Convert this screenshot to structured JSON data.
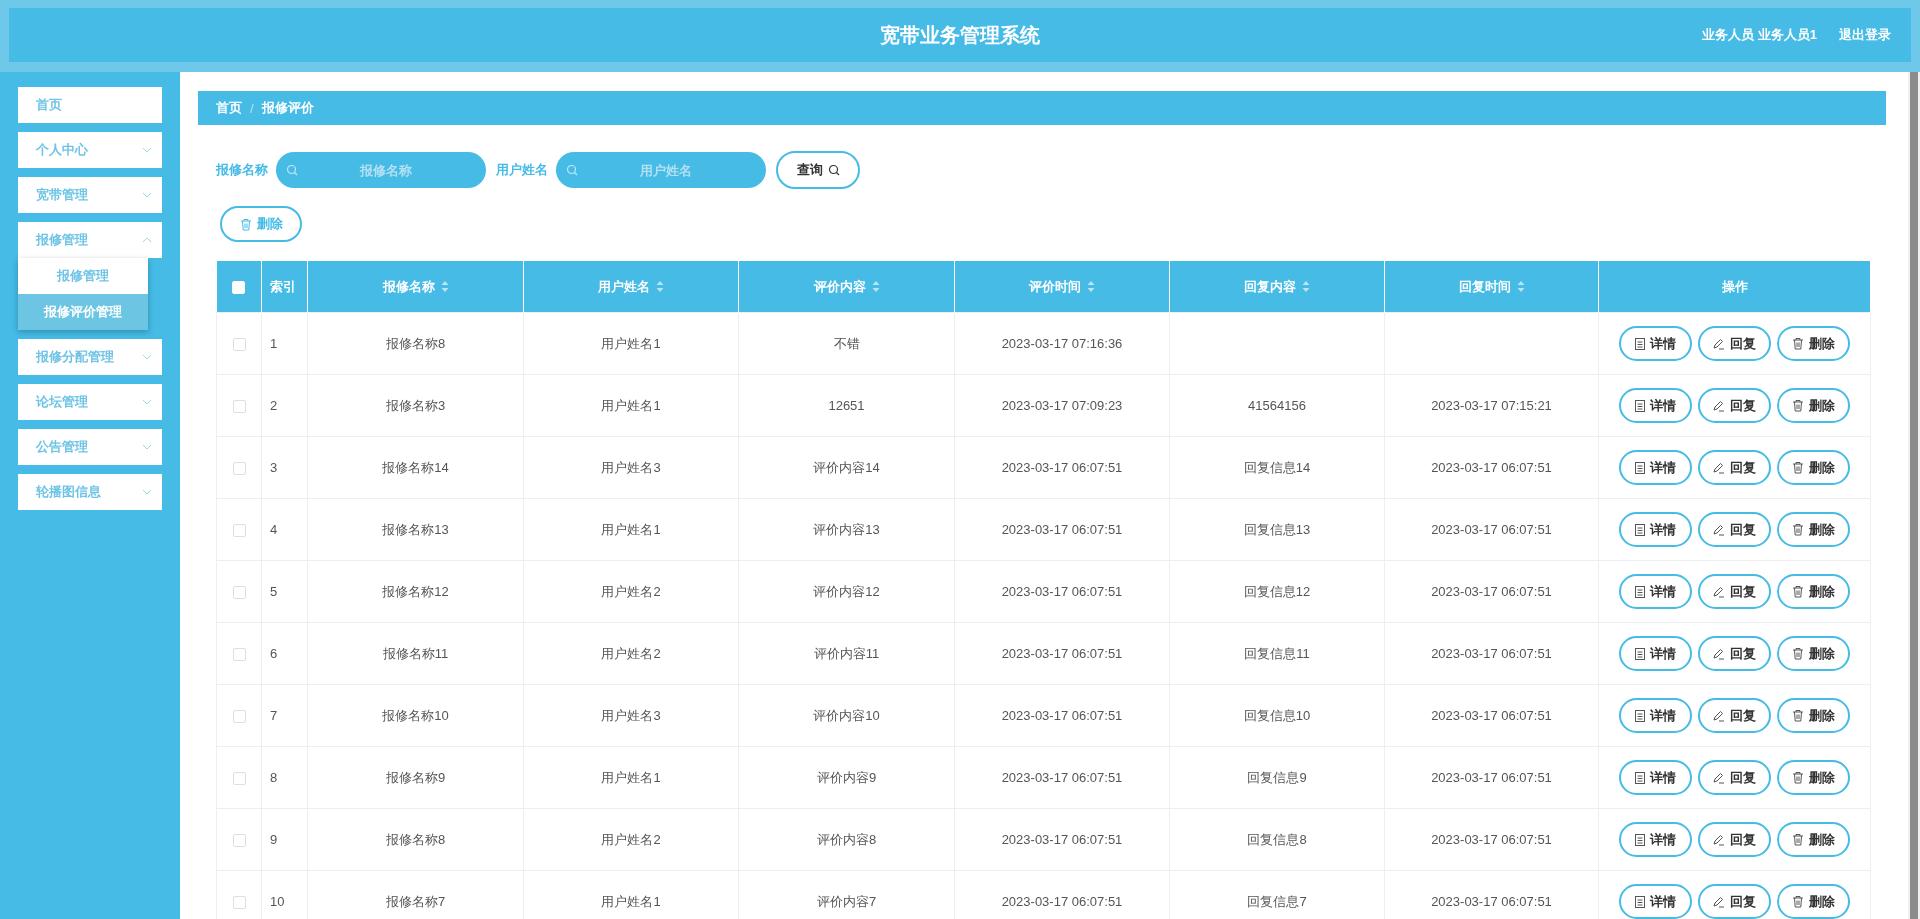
{
  "header": {
    "title": "宽带业务管理系统",
    "user": "业务人员 业务人员1",
    "logout": "退出登录"
  },
  "sidebar": {
    "items": [
      {
        "label": "首页",
        "kind": "link"
      },
      {
        "label": "个人中心",
        "kind": "menu",
        "expanded": false
      },
      {
        "label": "宽带管理",
        "kind": "menu",
        "expanded": false
      },
      {
        "label": "报修管理",
        "kind": "menu",
        "expanded": true,
        "children": [
          {
            "label": "报修管理",
            "selected": false
          },
          {
            "label": "报修评价管理",
            "selected": true
          }
        ]
      },
      {
        "label": "报修分配管理",
        "kind": "menu",
        "expanded": false
      },
      {
        "label": "论坛管理",
        "kind": "menu",
        "expanded": false
      },
      {
        "label": "公告管理",
        "kind": "menu",
        "expanded": false
      },
      {
        "label": "轮播图信息",
        "kind": "menu",
        "expanded": false
      }
    ]
  },
  "breadcrumb": {
    "items": [
      "首页",
      "报修评价"
    ],
    "separator": "/"
  },
  "search": {
    "fields": [
      {
        "label": "报修名称",
        "placeholder": "报修名称"
      },
      {
        "label": "用户姓名",
        "placeholder": "用户姓名"
      }
    ],
    "query_button": "查询",
    "delete_button": "删除"
  },
  "table": {
    "select_all_checked": false,
    "columns": [
      {
        "label": "索引",
        "sortable": false
      },
      {
        "label": "报修名称",
        "sortable": true
      },
      {
        "label": "用户姓名",
        "sortable": true
      },
      {
        "label": "评价内容",
        "sortable": true
      },
      {
        "label": "评价时间",
        "sortable": true
      },
      {
        "label": "回复内容",
        "sortable": true
      },
      {
        "label": "回复时间",
        "sortable": true
      },
      {
        "label": "操作",
        "sortable": false
      }
    ],
    "rows": [
      {
        "checked": false,
        "cells": [
          "1",
          "报修名称8",
          "用户姓名1",
          "不错",
          "2023-03-17 07:16:36",
          "",
          ""
        ],
        "actions": [
          "详情",
          "回复",
          "删除"
        ]
      },
      {
        "checked": false,
        "cells": [
          "2",
          "报修名称3",
          "用户姓名1",
          "12651",
          "2023-03-17 07:09:23",
          "41564156",
          "2023-03-17 07:15:21"
        ],
        "actions": [
          "详情",
          "回复",
          "删除"
        ]
      },
      {
        "checked": false,
        "cells": [
          "3",
          "报修名称14",
          "用户姓名3",
          "评价内容14",
          "2023-03-17 06:07:51",
          "回复信息14",
          "2023-03-17 06:07:51"
        ],
        "actions": [
          "详情",
          "回复",
          "删除"
        ]
      },
      {
        "checked": false,
        "cells": [
          "4",
          "报修名称13",
          "用户姓名1",
          "评价内容13",
          "2023-03-17 06:07:51",
          "回复信息13",
          "2023-03-17 06:07:51"
        ],
        "actions": [
          "详情",
          "回复",
          "删除"
        ]
      },
      {
        "checked": false,
        "cells": [
          "5",
          "报修名称12",
          "用户姓名2",
          "评价内容12",
          "2023-03-17 06:07:51",
          "回复信息12",
          "2023-03-17 06:07:51"
        ],
        "actions": [
          "详情",
          "回复",
          "删除"
        ]
      },
      {
        "checked": false,
        "cells": [
          "6",
          "报修名称11",
          "用户姓名2",
          "评价内容11",
          "2023-03-17 06:07:51",
          "回复信息11",
          "2023-03-17 06:07:51"
        ],
        "actions": [
          "详情",
          "回复",
          "删除"
        ]
      },
      {
        "checked": false,
        "cells": [
          "7",
          "报修名称10",
          "用户姓名3",
          "评价内容10",
          "2023-03-17 06:07:51",
          "回复信息10",
          "2023-03-17 06:07:51"
        ],
        "actions": [
          "详情",
          "回复",
          "删除"
        ]
      },
      {
        "checked": false,
        "cells": [
          "8",
          "报修名称9",
          "用户姓名1",
          "评价内容9",
          "2023-03-17 06:07:51",
          "回复信息9",
          "2023-03-17 06:07:51"
        ],
        "actions": [
          "详情",
          "回复",
          "删除"
        ]
      },
      {
        "checked": false,
        "cells": [
          "9",
          "报修名称8",
          "用户姓名2",
          "评价内容8",
          "2023-03-17 06:07:51",
          "回复信息8",
          "2023-03-17 06:07:51"
        ],
        "actions": [
          "详情",
          "回复",
          "删除"
        ]
      },
      {
        "checked": false,
        "cells": [
          "10",
          "报修名称7",
          "用户姓名1",
          "评价内容7",
          "2023-03-17 06:07:51",
          "回复信息7",
          "2023-03-17 06:07:51"
        ],
        "actions": [
          "详情",
          "回复",
          "删除"
        ]
      }
    ]
  }
}
